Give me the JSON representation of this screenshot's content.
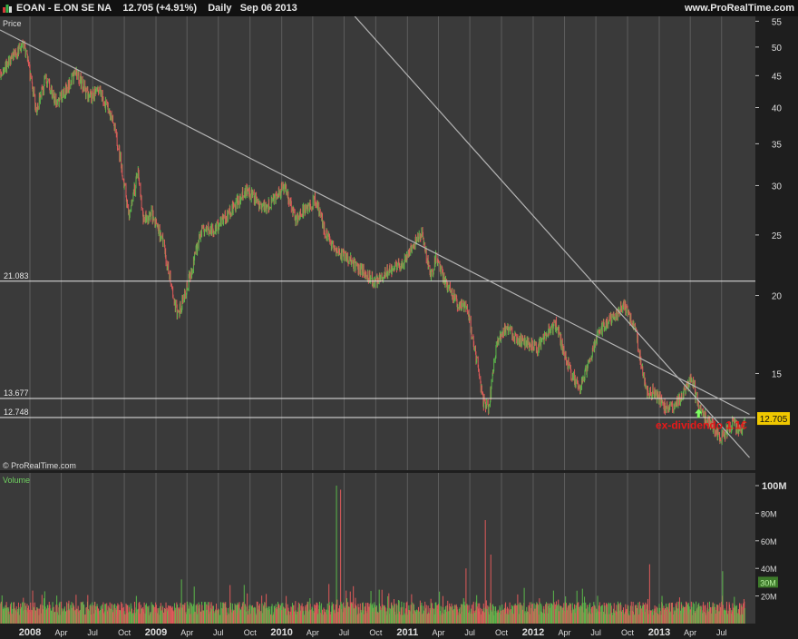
{
  "header": {
    "title": "EOAN - E.ON SE NA",
    "price_change": "12.705 (+4.91%)",
    "period": "Daily",
    "date": "Sep 06 2013",
    "brand": "www.ProRealTime.com"
  },
  "chart_data": [
    {
      "type": "candlestick",
      "panel": "price",
      "title": "Price",
      "watermark": "© ProRealTime.com",
      "y_scale": "log",
      "ylim": [
        10.5,
        56
      ],
      "y_ticks": [
        15,
        20,
        25,
        30,
        35,
        40,
        45,
        50,
        55
      ],
      "grid": true,
      "current_price_label": "12.705",
      "horizontal_lines": [
        {
          "label": "21.083",
          "value": 21.083
        },
        {
          "label": "13.677",
          "value": 13.677
        },
        {
          "label": "12.748",
          "value": 12.748
        }
      ],
      "trendlines": [
        {
          "from": {
            "date": "2007-09-15",
            "value": 54
          },
          "to": {
            "date": "2013-09-20",
            "value": 12.9
          }
        },
        {
          "from": {
            "date": "2010-08-01",
            "value": 56
          },
          "to": {
            "date": "2013-09-20",
            "value": 11.0
          }
        }
      ],
      "annotation": {
        "text": "ex-dividendo 1.1€",
        "date": "2013-05-03",
        "value": 12.4
      },
      "series": [
        {
          "values": [
            [
              "2007-09-01",
              43.5
            ],
            [
              "2007-11-01",
              47.0
            ],
            [
              "2007-12-15",
              51.0
            ],
            [
              "2008-01-20",
              39.5
            ],
            [
              "2008-02-15",
              44.5
            ],
            [
              "2008-03-20",
              40.5
            ],
            [
              "2008-05-15",
              45.5
            ],
            [
              "2008-06-20",
              41.5
            ],
            [
              "2008-07-20",
              42.5
            ],
            [
              "2008-09-01",
              38.0
            ],
            [
              "2008-10-15",
              27.0
            ],
            [
              "2008-11-10",
              31.5
            ],
            [
              "2008-11-25",
              26.5
            ],
            [
              "2008-12-20",
              27.0
            ],
            [
              "2009-01-20",
              24.5
            ],
            [
              "2009-03-05",
              18.5
            ],
            [
              "2009-04-15",
              22.0
            ],
            [
              "2009-05-15",
              25.5
            ],
            [
              "2009-06-20",
              25.5
            ],
            [
              "2009-08-10",
              27.5
            ],
            [
              "2009-09-20",
              29.5
            ],
            [
              "2009-11-15",
              27.5
            ],
            [
              "2010-01-10",
              30.0
            ],
            [
              "2010-02-10",
              26.5
            ],
            [
              "2010-03-10",
              27.5
            ],
            [
              "2010-04-10",
              28.5
            ],
            [
              "2010-05-10",
              25.0
            ],
            [
              "2010-06-10",
              23.5
            ],
            [
              "2010-07-10",
              23.0
            ],
            [
              "2010-08-20",
              22.0
            ],
            [
              "2010-10-01",
              21.0
            ],
            [
              "2010-11-10",
              22.0
            ],
            [
              "2010-12-15",
              22.5
            ],
            [
              "2011-01-10",
              23.5
            ],
            [
              "2011-02-10",
              25.2
            ],
            [
              "2011-03-10",
              21.5
            ],
            [
              "2011-03-25",
              23.0
            ],
            [
              "2011-04-20",
              21.0
            ],
            [
              "2011-05-25",
              19.5
            ],
            [
              "2011-06-25",
              19.0
            ],
            [
              "2011-07-10",
              17.0
            ],
            [
              "2011-08-10",
              13.5
            ],
            [
              "2011-08-25",
              13.2
            ],
            [
              "2011-09-15",
              16.5
            ],
            [
              "2011-10-15",
              17.8
            ],
            [
              "2011-11-15",
              17.0
            ],
            [
              "2011-12-15",
              16.8
            ],
            [
              "2012-01-15",
              16.5
            ],
            [
              "2012-02-10",
              17.5
            ],
            [
              "2012-03-10",
              18.0
            ],
            [
              "2012-03-25",
              16.5
            ],
            [
              "2012-04-20",
              15.0
            ],
            [
              "2012-05-15",
              14.2
            ],
            [
              "2012-06-10",
              15.5
            ],
            [
              "2012-07-10",
              17.5
            ],
            [
              "2012-08-20",
              18.5
            ],
            [
              "2012-09-20",
              19.3
            ],
            [
              "2012-10-25",
              17.5
            ],
            [
              "2012-11-10",
              15.5
            ],
            [
              "2012-11-25",
              14.0
            ],
            [
              "2012-12-20",
              14.0
            ],
            [
              "2013-01-20",
              13.2
            ],
            [
              "2013-02-15",
              13.3
            ],
            [
              "2013-03-10",
              13.8
            ],
            [
              "2013-04-05",
              14.8
            ],
            [
              "2013-04-25",
              13.2
            ],
            [
              "2013-05-20",
              12.6
            ],
            [
              "2013-06-10",
              12.3
            ],
            [
              "2013-06-25",
              11.8
            ],
            [
              "2013-07-15",
              12.1
            ],
            [
              "2013-08-05",
              12.5
            ],
            [
              "2013-08-25",
              12.0
            ],
            [
              "2013-09-06",
              12.7
            ]
          ]
        }
      ]
    },
    {
      "type": "bar",
      "panel": "volume",
      "title": "Volume",
      "ylim": [
        0,
        100
      ],
      "y_ticks": [
        "20M",
        "40M",
        "60M",
        "80M",
        "100M"
      ],
      "current_value_label": "30M",
      "spikes": [
        {
          "date": "2009-03-15",
          "value": 32
        },
        {
          "date": "2009-09-15",
          "value": 28
        },
        {
          "date": "2010-06-10",
          "value": 100
        },
        {
          "date": "2010-06-20",
          "value": 97
        },
        {
          "date": "2011-06-20",
          "value": 40
        },
        {
          "date": "2011-08-15",
          "value": 75
        },
        {
          "date": "2011-09-01",
          "value": 50
        },
        {
          "date": "2012-12-05",
          "value": 43
        },
        {
          "date": "2013-07-05",
          "value": 38
        }
      ]
    }
  ],
  "x_axis": {
    "ticks": [
      {
        "date": "2008-01-01",
        "label": "2008",
        "major": true
      },
      {
        "date": "2008-04-01",
        "label": "Apr"
      },
      {
        "date": "2008-07-01",
        "label": "Jul"
      },
      {
        "date": "2008-10-01",
        "label": "Oct"
      },
      {
        "date": "2009-01-01",
        "label": "2009",
        "major": true
      },
      {
        "date": "2009-04-01",
        "label": "Apr"
      },
      {
        "date": "2009-07-01",
        "label": "Jul"
      },
      {
        "date": "2009-10-01",
        "label": "Oct"
      },
      {
        "date": "2010-01-01",
        "label": "2010",
        "major": true
      },
      {
        "date": "2010-04-01",
        "label": "Apr"
      },
      {
        "date": "2010-07-01",
        "label": "Jul"
      },
      {
        "date": "2010-10-01",
        "label": "Oct"
      },
      {
        "date": "2011-01-01",
        "label": "2011",
        "major": true
      },
      {
        "date": "2011-04-01",
        "label": "Apr"
      },
      {
        "date": "2011-07-01",
        "label": "Jul"
      },
      {
        "date": "2011-10-01",
        "label": "Oct"
      },
      {
        "date": "2012-01-01",
        "label": "2012",
        "major": true
      },
      {
        "date": "2012-04-01",
        "label": "Apr"
      },
      {
        "date": "2012-07-01",
        "label": "Jul"
      },
      {
        "date": "2012-10-01",
        "label": "Oct"
      },
      {
        "date": "2013-01-01",
        "label": "2013",
        "major": true
      },
      {
        "date": "2013-04-01",
        "label": "Apr"
      },
      {
        "date": "2013-07-01",
        "label": "Jul"
      }
    ]
  },
  "colors": {
    "up": "#5ab84a",
    "down": "#e05a5a",
    "panel_bg": "#3a3a3a",
    "grid": "#7a7a7a",
    "trendline": "#b4b4b4",
    "annotation": "#e81818",
    "price_tag": "#f0c800"
  }
}
